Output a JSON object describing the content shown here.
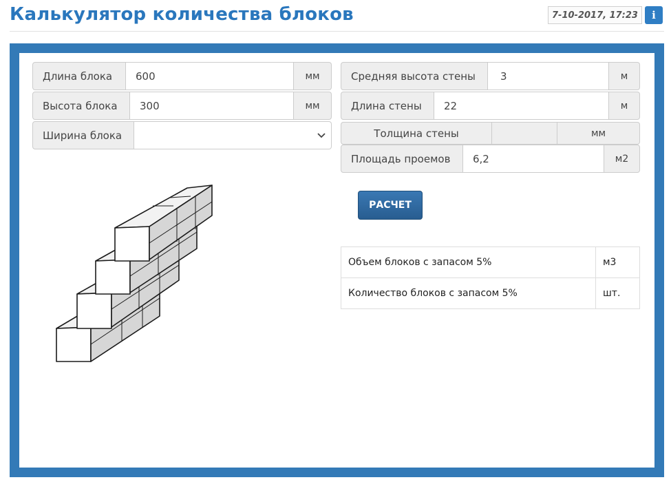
{
  "header": {
    "title": "Калькулятор количества блоков",
    "datetime": "7-10-2017, 17:23",
    "info_icon": "i"
  },
  "left_inputs": {
    "block_length": {
      "label": "Длина блока",
      "value": "600",
      "unit": "мм"
    },
    "block_height": {
      "label": "Высота блока",
      "value": "300",
      "unit": "мм"
    },
    "block_width": {
      "label": "Ширина блока",
      "value": ""
    }
  },
  "right_inputs": {
    "wall_height": {
      "label": "Средняя высота стены",
      "value": "3",
      "unit": "м"
    },
    "wall_length": {
      "label": "Длина стены",
      "value": "22",
      "unit": "м"
    },
    "wall_thickness": {
      "label": "Толщина стены",
      "unit": "мм"
    },
    "openings_area": {
      "label": "Площадь проемов",
      "value": "6,2",
      "unit": "м2"
    }
  },
  "calc_button": "РАСЧЕТ",
  "results": [
    {
      "label": "Объем блоков с запасом 5%",
      "unit": "м3"
    },
    {
      "label": "Количество блоков с запасом 5%",
      "unit": "шт."
    }
  ],
  "colors": {
    "accent": "#2a77bd",
    "frame": "#337ab7",
    "button": "#2f6aa3"
  },
  "icons": {
    "info": "info-icon",
    "select_arrow": "chevron-down-icon",
    "wall_image": "brick-wall-illustration"
  }
}
